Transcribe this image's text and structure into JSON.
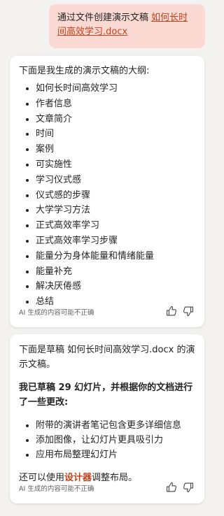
{
  "user_message": {
    "text": "通过文件创建演示文稿",
    "link": "如何长时间高效学习.docx"
  },
  "outline_card": {
    "intro": "下面是我生成的演示文稿的大纲:",
    "items": [
      "如何长时间高效学习",
      "作者信息",
      "文章简介",
      "时间",
      "案例",
      "可实施性",
      "学习仪式感",
      "仪式感的步骤",
      "大学学习方法",
      "正式高效率学习",
      "正式高效率学习步骤",
      "能量分为身体能量和情绪能量",
      "能量补充",
      "解决厌倦感",
      "总结"
    ],
    "disclaimer": "AI 生成的内容可能不正确"
  },
  "draft_card": {
    "para1": "下面是草稿 如何长时间高效学习.docx 的演示文稿。",
    "para2": "我已草稿 29 幻灯片，并根据你的文档进行了一些更改:",
    "changes": [
      "附带的演讲者笔记包含更多详细信息",
      "添加图像，让幻灯片更具吸引力",
      "应用布局整理幻灯片"
    ],
    "para3_before": "还可以使用",
    "designer_link": "设计器",
    "para3_after": "调整布局。",
    "disclaimer": "AI 生成的内容可能不正确"
  },
  "colors": {
    "accent": "#c4421a",
    "user_bubble": "#f9d9d2",
    "background": "#f3f2f1"
  },
  "icons": {
    "like": "thumbs-up-icon",
    "dislike": "thumbs-down-icon"
  }
}
